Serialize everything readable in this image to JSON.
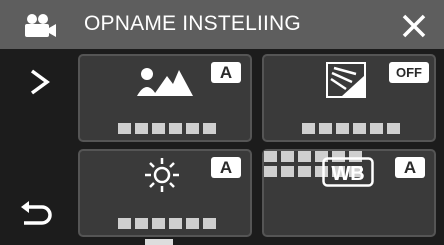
{
  "header": {
    "mode_icon": "movie-camera-icon",
    "title": "OPNAME INSTELIING",
    "close_icon": "close-x-icon"
  },
  "nav": {
    "next_icon": "chevron-right-icon",
    "back_icon": "return-arrow-icon"
  },
  "tiles": [
    {
      "name": "scene-select",
      "icon": "portrait-landscape-icon",
      "status": "A"
    },
    {
      "name": "backlight-compensation",
      "icon": "backlight-icon",
      "status": "OFF"
    },
    {
      "name": "brightness",
      "icon": "sun-brightness-icon",
      "status": "A"
    },
    {
      "name": "white-balance",
      "icon": "wb-icon",
      "status": "A",
      "icon_label": "WB"
    }
  ],
  "colors": {
    "background": "#1c1c1c",
    "header": "#5e5e5e",
    "tile": "#3a3a3a",
    "badge": "#ffffff"
  }
}
